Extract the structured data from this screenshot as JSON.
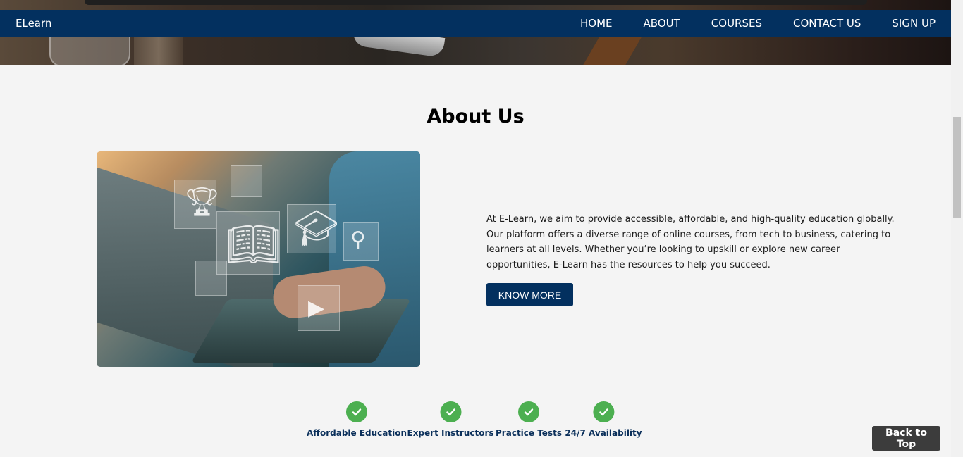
{
  "navbar": {
    "brand": "ELearn",
    "links": [
      "HOME",
      "ABOUT",
      "COURSES",
      "CONTACT US",
      "SIGN UP"
    ]
  },
  "about": {
    "title": "About Us",
    "text": "At E-Learn, we aim to provide accessible, affordable, and high-quality education globally. Our platform offers a diverse range of online courses, from tech to business, catering to learners at all levels. Whether you’re looking to upskill or explore new career opportunities, E-Learn has the resources to help you succeed.",
    "button_label": "KNOW MORE"
  },
  "features": [
    {
      "label": "Affordable Education",
      "icon": "check-circle-icon"
    },
    {
      "label": "Expert Instructors",
      "icon": "check-circle-icon"
    },
    {
      "label": "Practice Tests",
      "icon": "check-circle-icon"
    },
    {
      "label": "24/7 Availability",
      "icon": "check-circle-icon"
    }
  ],
  "back_to_top": "Back to Top",
  "colors": {
    "navbar": "#03305f",
    "check": "#4caf50",
    "back_to_top_bg": "#3c3c3c",
    "page_bg": "#f4f4f4"
  }
}
